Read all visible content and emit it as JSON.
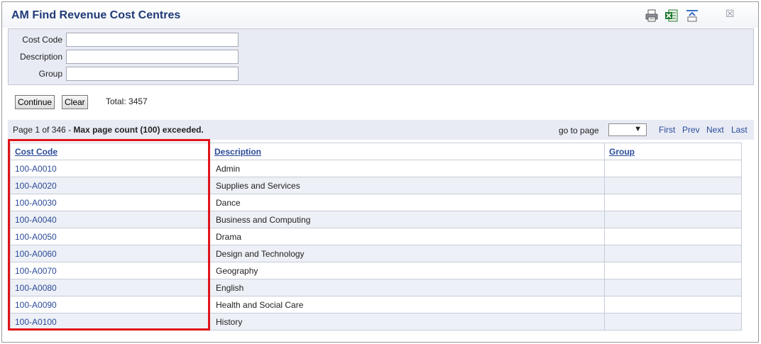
{
  "window": {
    "title": "AM Find Revenue Cost Centres",
    "toolbar_icons": [
      "print-icon",
      "excel-export-icon",
      "collapse-icon"
    ],
    "close_glyph": "☒"
  },
  "search": {
    "cost_code_label": "Cost Code",
    "cost_code_value": "",
    "description_label": "Description",
    "description_value": "",
    "group_label": "Group",
    "group_value": ""
  },
  "actions": {
    "continue_label": "Continue",
    "clear_label": "Clear",
    "total_text": "Total: 3457"
  },
  "pager": {
    "page_text": "Page 1 of 346 - ",
    "warning_text": "Max page count (100) exceeded.",
    "goto_label": "go to page",
    "goto_value": "",
    "first": "First",
    "prev": "Prev",
    "next": "Next",
    "last": "Last"
  },
  "table": {
    "columns": [
      "Cost Code",
      "Description",
      "Group"
    ],
    "rows": [
      {
        "code": "100-A0010",
        "description": "Admin",
        "group": ""
      },
      {
        "code": "100-A0020",
        "description": "Supplies and Services",
        "group": ""
      },
      {
        "code": "100-A0030",
        "description": "Dance",
        "group": ""
      },
      {
        "code": "100-A0040",
        "description": "Business and Computing",
        "group": ""
      },
      {
        "code": "100-A0050",
        "description": "Drama",
        "group": ""
      },
      {
        "code": "100-A0060",
        "description": "Design and Technology",
        "group": ""
      },
      {
        "code": "100-A0070",
        "description": "Geography",
        "group": ""
      },
      {
        "code": "100-A0080",
        "description": "English",
        "group": ""
      },
      {
        "code": "100-A0090",
        "description": "Health and Social Care",
        "group": ""
      },
      {
        "code": "100-A0100",
        "description": "History",
        "group": ""
      }
    ]
  },
  "colors": {
    "title": "#1f3a78",
    "link": "#2a4b9a",
    "panel": "#e8ebf4",
    "highlight": "#e0141b"
  }
}
